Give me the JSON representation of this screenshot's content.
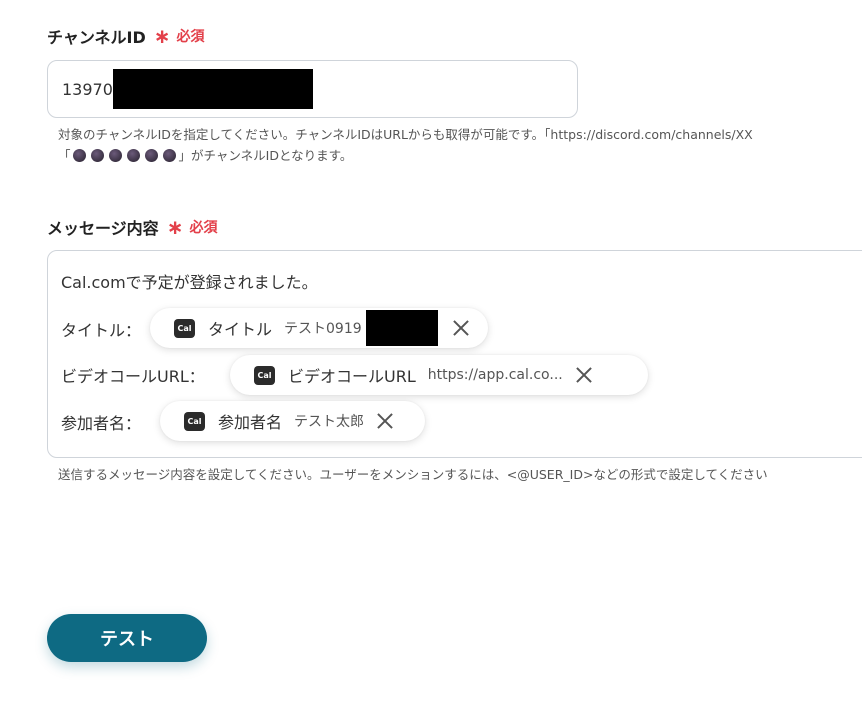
{
  "channel_field": {
    "label": "チャンネルID",
    "required_star": "∗",
    "required_text": "必須",
    "value": "13970",
    "help_line1": "対象のチャンネルIDを指定してください。チャンネルIDはURLからも取得が可能です。「https://discord.com/channels/XX",
    "help_line2_prefix": "「",
    "help_line2_suffix": "」がチャンネルIDとなります。"
  },
  "message_field": {
    "label": "メッセージ内容",
    "required_star": "∗",
    "required_text": "必須",
    "first_line": "Cal.comで予定が登録されました。",
    "rows": [
      {
        "prefix": "タイトル：",
        "chip_name": "タイトル",
        "chip_value": "テスト0919",
        "icon": "cal-icon"
      },
      {
        "prefix": "ビデオコールURL：",
        "chip_name": "ビデオコールURL",
        "chip_value": "https://app.cal.co...",
        "icon": "cal-icon"
      },
      {
        "prefix": "参加者名：",
        "chip_name": "参加者名",
        "chip_value": "テスト太郎",
        "icon": "cal-icon"
      }
    ],
    "help": "送信するメッセージ内容を設定してください。ユーザーをメンションするには、<@USER_ID>などの形式で設定してください"
  },
  "icon_text": "Cal",
  "test_button": {
    "label": "テスト"
  },
  "colors": {
    "accent": "#0e6a83",
    "required": "#e3404a",
    "border": "#cfd4da"
  }
}
